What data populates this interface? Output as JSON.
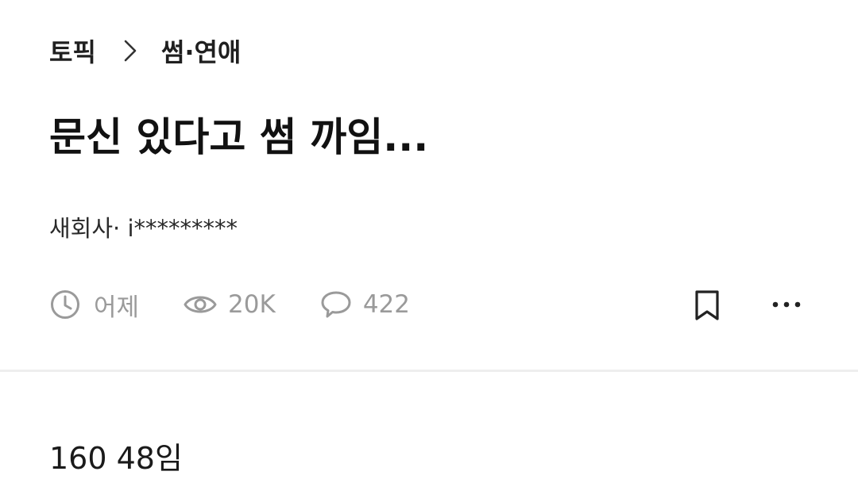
{
  "breadcrumb": {
    "root": "토픽",
    "category": "썸·연애"
  },
  "post": {
    "title": "문신 있다고 썸 까임...",
    "author": "새회사· i*********",
    "time": "어제",
    "views": "20K",
    "comments": "422",
    "body": "160 48임"
  },
  "colors": {
    "meta_gray": "#9a9a9a",
    "text_dark": "#111111",
    "divider": "#eeeeee"
  },
  "icons": {
    "breadcrumb_separator": "chevron-right-icon",
    "time": "clock-icon",
    "views": "eye-icon",
    "comments": "speech-bubble-icon",
    "bookmark": "bookmark-icon",
    "more": "more-horizontal-icon"
  }
}
